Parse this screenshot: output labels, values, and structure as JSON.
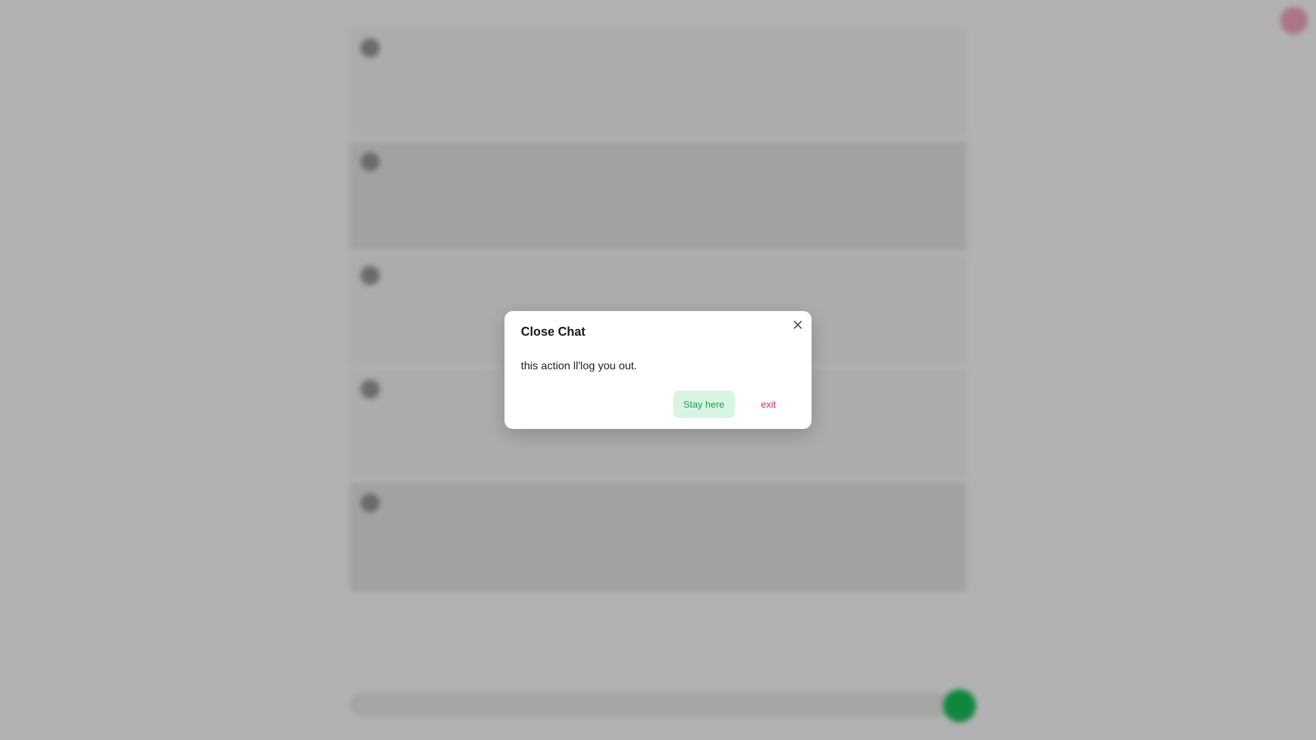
{
  "dialog": {
    "title": "Close Chat",
    "message": "this action ll'log you out.",
    "primary_label": "Stay here",
    "secondary_label": "exit",
    "close_icon": "close-icon",
    "colors": {
      "primary_bg": "#d8f5e3",
      "primary_text": "#16a34a",
      "secondary_text": "#e11d62"
    }
  },
  "background": {
    "messages": [
      {
        "sender": "",
        "text": "",
        "time": ""
      },
      {
        "sender": "",
        "text": "",
        "time": ""
      },
      {
        "sender": "",
        "text": "",
        "time": ""
      },
      {
        "sender": "",
        "text": "",
        "time": ""
      },
      {
        "sender": "",
        "text": "",
        "time": ""
      }
    ],
    "composer_placeholder": "",
    "send_icon": "send-icon",
    "corner_icon": "menu-icon",
    "colors": {
      "send_button": "#18c15a",
      "corner_button": "#f5a7c3"
    }
  }
}
